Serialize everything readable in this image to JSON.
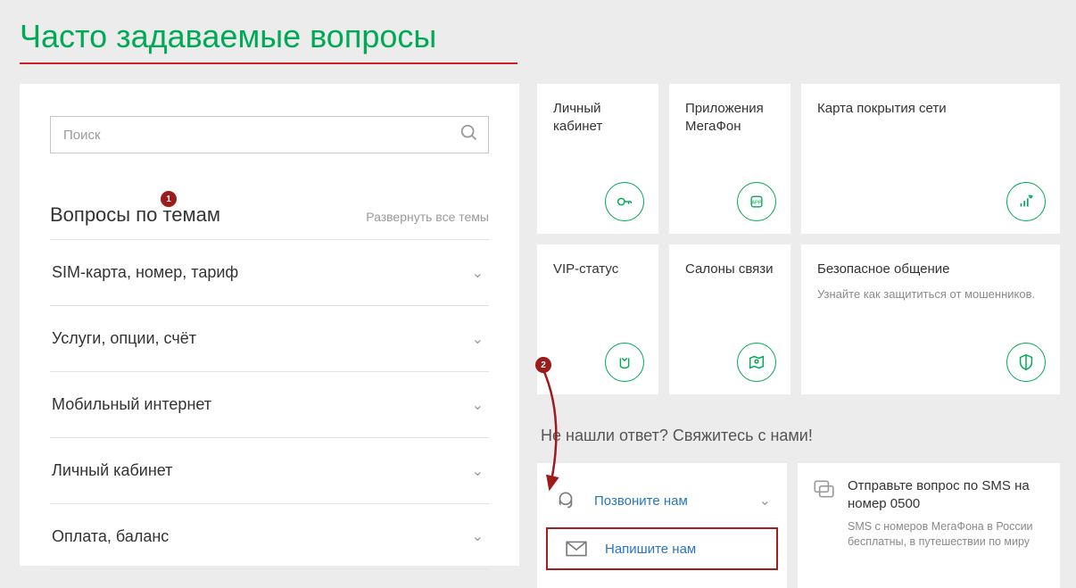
{
  "title": "Часто задаваемые вопросы",
  "search": {
    "placeholder": "Поиск"
  },
  "topics": {
    "heading": "Вопросы по темам",
    "expand_all": "Развернуть все темы",
    "items": [
      "SIM-карта, номер, тариф",
      "Услуги, опции, счёт",
      "Мобильный интернет",
      "Личный кабинет",
      "Оплата, баланс"
    ]
  },
  "cards": [
    {
      "title": "Личный кабинет"
    },
    {
      "title": "Приложения МегаФон"
    },
    {
      "title": "Карта покрытия сети"
    },
    {
      "title": "VIP-статус"
    },
    {
      "title": "Салоны связи"
    },
    {
      "title": "Безопасное общение",
      "sub": "Узнайте как защититься от мошенников."
    }
  ],
  "contact": {
    "heading": "Не нашли ответ? Свяжитесь с нами!",
    "call": "Позвоните нам",
    "write": "Напишите нам",
    "sms_title": "Отправьте вопрос по SMS на номер 0500",
    "sms_sub": "SMS с номеров МегаФона в России бесплатны, в путешествии по миру"
  },
  "annotations": {
    "b1": "1",
    "b2": "2"
  }
}
